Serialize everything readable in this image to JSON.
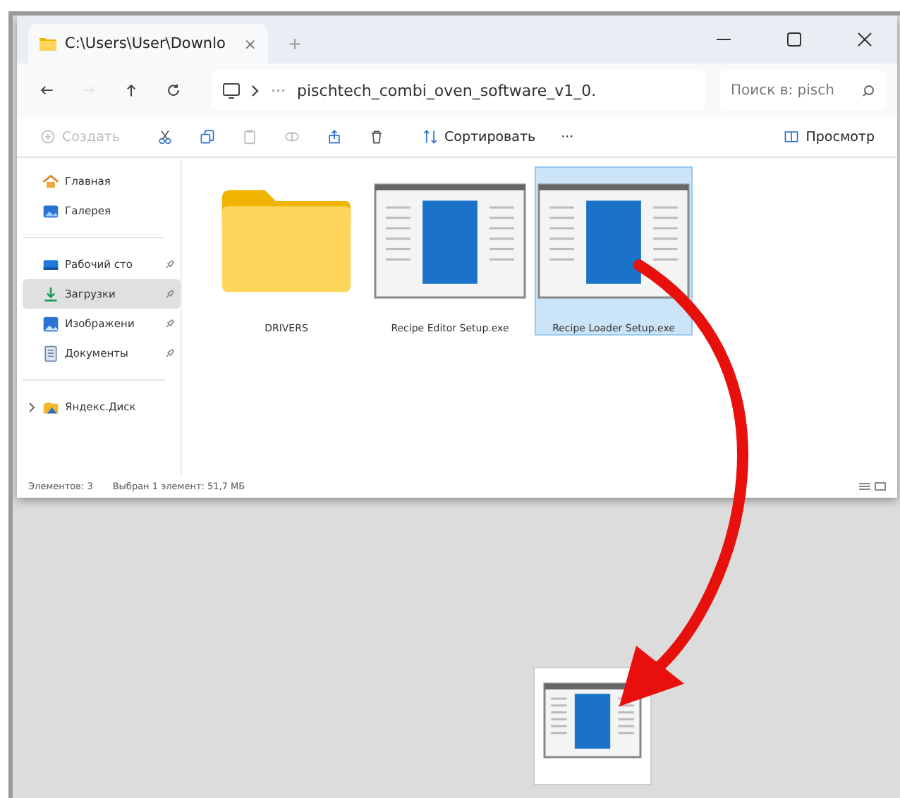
{
  "window": {
    "tab_title": "C:\\Users\\User\\Downlo",
    "tab_close": "×",
    "new_tab": "+"
  },
  "nav": [
    {
      "kind": "back",
      "disabled": false
    },
    {
      "kind": "forward",
      "disabled": true
    },
    {
      "kind": "up",
      "disabled": false
    },
    {
      "kind": "refresh",
      "disabled": false
    }
  ],
  "address": {
    "overflow": "···",
    "path": "pischtech_combi_oven_software_v1_0."
  },
  "search": {
    "placeholder": "Поиск в: pisch"
  },
  "toolbar": [
    {
      "kind": "create",
      "label": "Создать",
      "disabled": true
    },
    {
      "kind": "cut",
      "disabled": false
    },
    {
      "kind": "copy",
      "disabled": false
    },
    {
      "kind": "paste",
      "disabled": true
    },
    {
      "kind": "rename",
      "disabled": true
    },
    {
      "kind": "share",
      "disabled": false
    },
    {
      "kind": "delete",
      "disabled": false
    },
    {
      "kind": "sort",
      "label": "Сортировать",
      "disabled": false
    },
    {
      "kind": "more",
      "label": "···",
      "disabled": false
    },
    {
      "kind": "view",
      "label": "Просмотр",
      "disabled": false
    }
  ],
  "sidebar": {
    "items": [
      {
        "kind": "home",
        "label": "Главная",
        "pinned": false,
        "selected": false
      },
      {
        "kind": "gallery",
        "label": "Галерея",
        "pinned": false,
        "selected": false
      },
      {
        "kind": "desktop",
        "label": "Рабочий сто",
        "pinned": true,
        "selected": false
      },
      {
        "kind": "downloads",
        "label": "Загрузки",
        "pinned": true,
        "selected": true
      },
      {
        "kind": "pictures",
        "label": "Изображени",
        "pinned": true,
        "selected": false
      },
      {
        "kind": "documents",
        "label": "Документы",
        "pinned": true,
        "selected": false
      },
      {
        "kind": "cloud",
        "label": "Яндекс.Диск",
        "pinned": false,
        "selected": false,
        "expandable": true
      }
    ]
  },
  "files": [
    {
      "kind": "folder",
      "name": "DRIVERS",
      "selected": false
    },
    {
      "kind": "exe",
      "name": "Recipe Editor Setup.exe",
      "selected": false
    },
    {
      "kind": "exe",
      "name": "Recipe Loader Setup.exe",
      "selected": true
    }
  ],
  "status_bar": {
    "count": "Элементов: 3",
    "selection": "Выбран 1 элемент: 51,7 МБ"
  },
  "desktop": {
    "icons": [
      {
        "kind": "exe"
      }
    ]
  }
}
